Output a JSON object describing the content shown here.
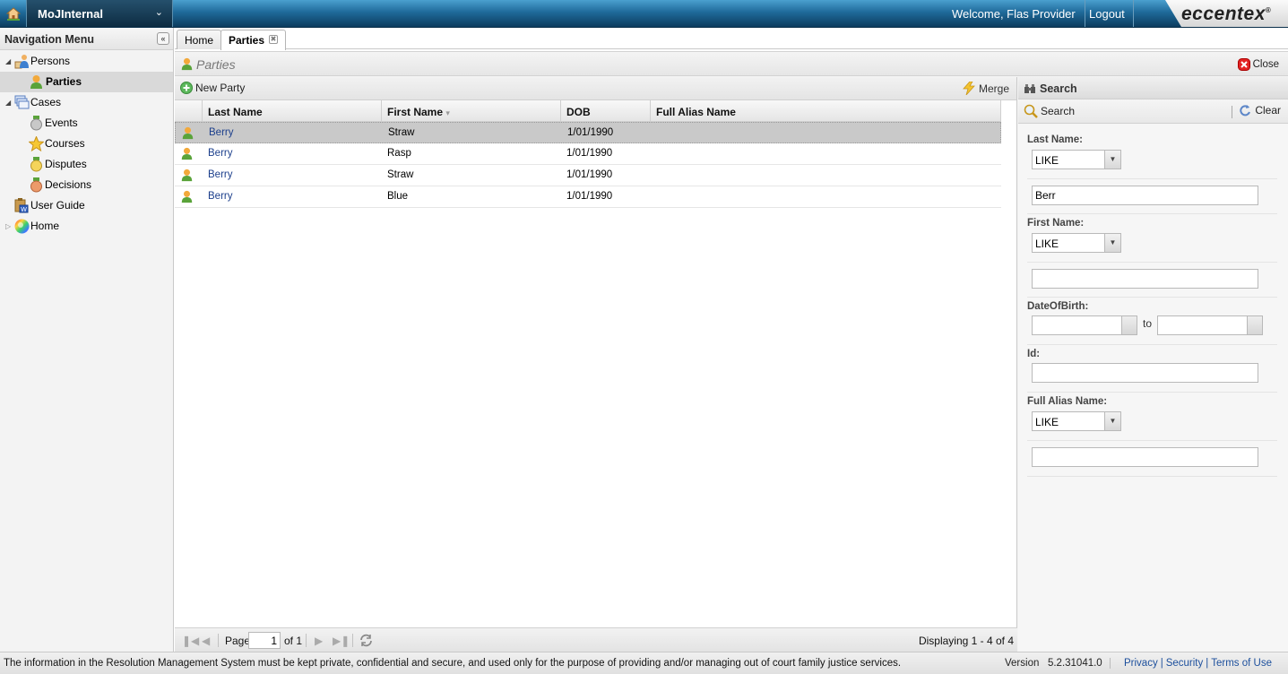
{
  "topbar": {
    "app_name": "MoJInternal",
    "welcome": "Welcome, Flas Provider",
    "logout": "Logout",
    "brand": "eccentex",
    "brand_mark": "®"
  },
  "nav": {
    "title": "Navigation Menu",
    "collapse_glyph": "«",
    "items": [
      {
        "label": "Persons",
        "icon": "persons-icon"
      },
      {
        "label": "Parties",
        "icon": "person-icon",
        "selected": true
      },
      {
        "label": "Cases",
        "icon": "cases-icon"
      },
      {
        "label": "Events",
        "icon": "gray-medal-icon"
      },
      {
        "label": "Courses",
        "icon": "star-icon"
      },
      {
        "label": "Disputes",
        "icon": "yellow-medal-icon"
      },
      {
        "label": "Decisions",
        "icon": "orange-medal-icon"
      },
      {
        "label": "User Guide",
        "icon": "user-guide-icon"
      },
      {
        "label": "Home",
        "icon": "color-wheel-icon"
      }
    ]
  },
  "tabs": [
    {
      "label": "Home"
    },
    {
      "label": "Parties",
      "active": true
    }
  ],
  "panel": {
    "title": "Parties",
    "close_label": "Close"
  },
  "grid": {
    "new_label": "New Party",
    "merge_label": "Merge",
    "columns": [
      "Last Name",
      "First Name",
      "DOB",
      "Full Alias Name"
    ],
    "sort_indicator": "▾",
    "rows": [
      {
        "last": "Berry",
        "first": "Straw",
        "dob": "1/01/1990",
        "alias": "",
        "selected": true
      },
      {
        "last": "Berry",
        "first": "Rasp",
        "dob": "1/01/1990",
        "alias": ""
      },
      {
        "last": "Berry",
        "first": "Straw",
        "dob": "1/01/1990",
        "alias": ""
      },
      {
        "last": "Berry",
        "first": "Blue",
        "dob": "1/01/1990",
        "alias": ""
      }
    ]
  },
  "pager": {
    "page_label": "Page",
    "page_value": "1",
    "of_label": "of 1",
    "displaying": "Displaying 1 - 4 of 4"
  },
  "search": {
    "title": "Search",
    "search_label": "Search",
    "clear_label": "Clear",
    "last_name_label": "Last Name:",
    "last_name_op": "LIKE",
    "last_name_value": "Berr",
    "first_name_label": "First Name:",
    "first_name_op": "LIKE",
    "first_name_value": "",
    "dob_label": "DateOfBirth:",
    "dob_to": "to",
    "dob_from_value": "",
    "dob_to_value": "",
    "id_label": "Id:",
    "id_value": "",
    "alias_label": "Full Alias Name:",
    "alias_op": "LIKE",
    "alias_value": ""
  },
  "footer": {
    "disclaimer": "The information in the Resolution Management System must be kept private, confidential and secure, and used only for the purpose of providing and/or managing out of court family justice services.",
    "version_label": "Version",
    "version": "5.2.31041.0",
    "links": [
      "Privacy",
      "Security",
      "Terms of Use"
    ]
  },
  "colors": {
    "topbar": "#1f6a9a",
    "link": "#1c3f8c",
    "selected_row": "#c9c9c9"
  }
}
